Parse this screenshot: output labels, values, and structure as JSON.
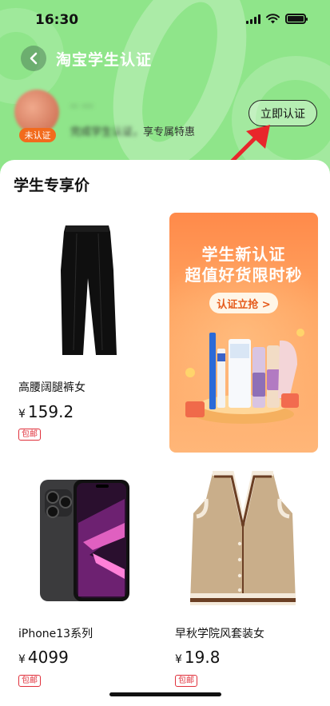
{
  "status_bar": {
    "time": "16:30"
  },
  "nav": {
    "title": "淘宝学生认证"
  },
  "user": {
    "name": "·· ···",
    "badge": "未认证",
    "subtitle_blurred": "完成学生认证，",
    "subtitle_visible": "享专属特惠"
  },
  "verify_button": {
    "label": "立即认证"
  },
  "section": {
    "title": "学生专享价"
  },
  "products": [
    {
      "name": "高腰阔腿裤女",
      "currency": "¥",
      "price": "159.2",
      "tag": "包邮"
    },
    {
      "name": "iPhone13系列",
      "currency": "¥",
      "price": "4099",
      "tag": "包邮"
    },
    {
      "name": "早秋学院风套装女",
      "currency": "¥",
      "price": "19.8",
      "tag": "包邮"
    }
  ],
  "banner": {
    "title_line1": "学生新认证",
    "title_line2": "超值好货限时秒",
    "button": "认证立抢 >"
  },
  "colors": {
    "header_green": "#8FE58A",
    "badge_orange": "#F26B1D",
    "tag_red": "#E0303B",
    "banner_orange": "#FF8A4A"
  }
}
